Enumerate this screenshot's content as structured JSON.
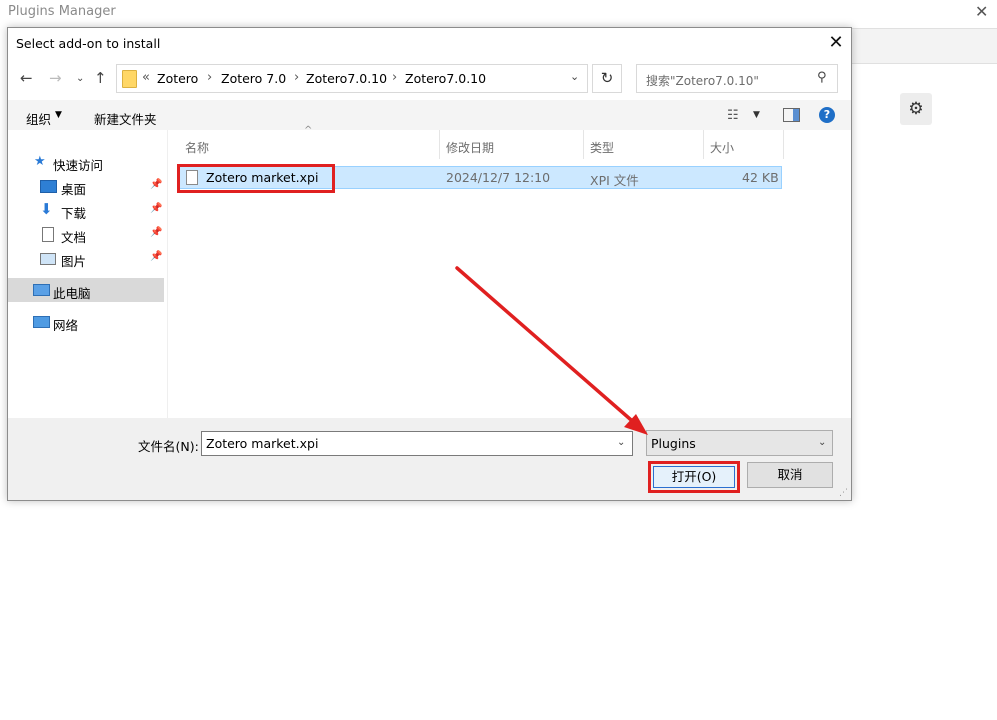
{
  "background_window": {
    "title": "Plugins Manager",
    "close_glyph": "✕",
    "gear_icon": "gear-icon"
  },
  "dialog": {
    "title": "Select add-on to install",
    "close_glyph": "✕",
    "address_bar": {
      "prefix": "«",
      "segments": [
        "Zotero",
        "Zotero 7.0",
        "Zotero7.0.10",
        "Zotero7.0.10"
      ]
    },
    "search_placeholder": "搜索\"Zotero7.0.10\"",
    "toolbar": {
      "organize": "组织",
      "new_folder": "新建文件夹"
    },
    "nav": {
      "quick_access": "快速访问",
      "desktop": "桌面",
      "downloads": "下载",
      "documents": "文档",
      "pictures": "图片",
      "this_pc": "此电脑",
      "network": "网络"
    },
    "columns": {
      "name": "名称",
      "modified": "修改日期",
      "type": "类型",
      "size": "大小"
    },
    "files": [
      {
        "name": "Zotero market.xpi",
        "modified": "2024/12/7 12:10",
        "type": "XPI 文件",
        "size": "42 KB"
      }
    ],
    "filename_label": "文件名(N):",
    "filename_value": "Zotero market.xpi",
    "filter_value": "Plugins",
    "open_button": "打开(O)",
    "cancel_button": "取消"
  },
  "colors": {
    "annotation_red": "#e02020",
    "selection_blue": "#cce8ff",
    "accent_blue": "#1f6fc7"
  }
}
